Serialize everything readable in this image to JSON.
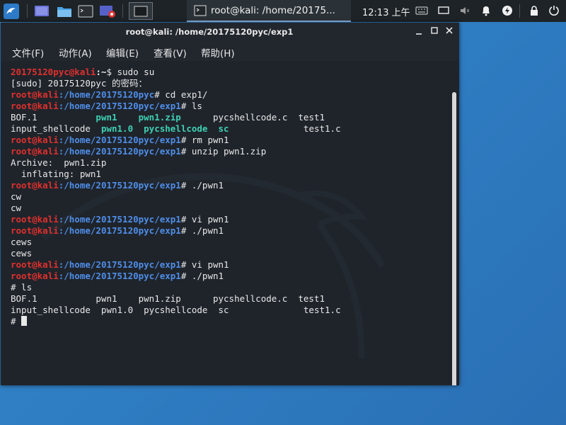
{
  "panel": {
    "task_title": "root@kali: /home/20175...",
    "clock": "12:13 上午"
  },
  "window": {
    "title": "root@kali: /home/20175120pyc/exp1"
  },
  "menu": [
    "文件(F)",
    "动作(A)",
    "编辑(E)",
    "查看(V)",
    "帮助(H)"
  ],
  "terminal": {
    "l1_user": "20175120pyc@kali",
    "l1_path": ":~",
    "l1_cmd": "$ sudo su",
    "l2": "[sudo] 20175120pyc 的密码：",
    "root_prompt": "root@kali",
    "path_home": ":/home/20175120pyc",
    "path_exp1": ":/home/20175120pyc/exp1",
    "cmd_cd": "# cd exp1/",
    "cmd_ls": "# ls",
    "ls1_a": "BOF.1           ",
    "ls1_b": "pwn1    pwn1.zip",
    "ls1_c": "      pycshellcode.c  test1",
    "ls2_a": "input_shellcode  ",
    "ls2_b": "pwn1.0  pycshellcode  sc",
    "ls2_c": "              test1.c",
    "cmd_rm": "# rm pwn1",
    "cmd_unzip": "# unzip pwn1.zip",
    "archive": "Archive:  pwn1.zip",
    "inflating": "  inflating: pwn1",
    "cmd_run": "# ./pwn1",
    "out_cw": "cw",
    "cmd_vi": "# vi pwn1",
    "out_cews": "cews",
    "shell_ls": "# ls",
    "ls3": "BOF.1           pwn1    pwn1.zip      pycshellcode.c  test1",
    "ls4": "input_shellcode  pwn1.0  pycshellcode  sc              test1.c",
    "shell_prompt": "# "
  }
}
